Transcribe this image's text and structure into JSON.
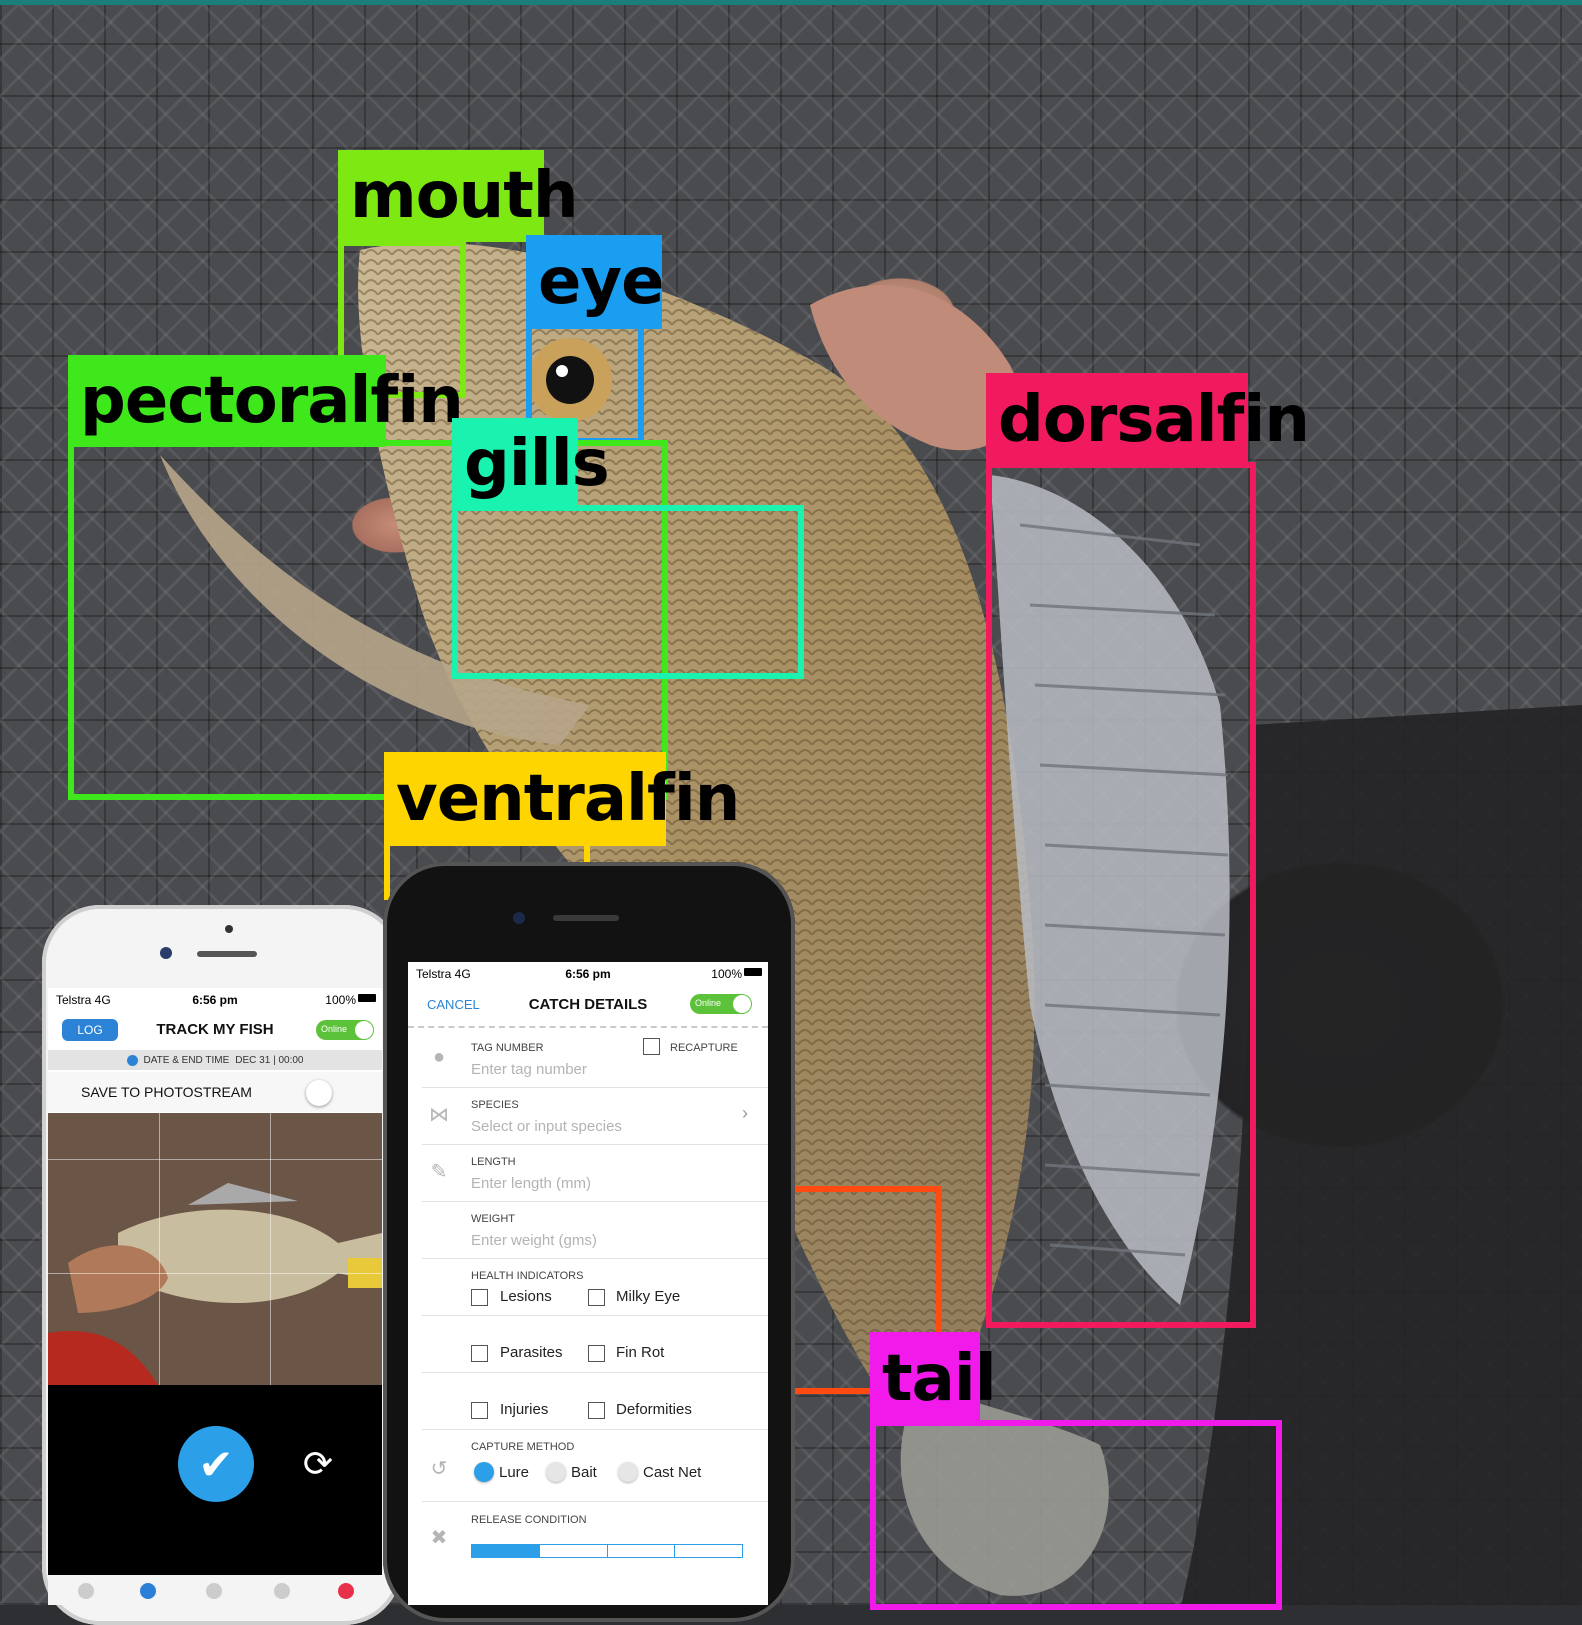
{
  "labels": {
    "mouth": "mouth",
    "eye": "eye",
    "pectoralfin": "pectoralfin",
    "gills": "gills",
    "dorsalfin": "dorsalfin",
    "ventralfin": "ventralfin",
    "tail": "tail"
  },
  "colors": {
    "mouth": "#7de812",
    "eye": "#1a9ef2",
    "pectoralfin": "#3ee81a",
    "gills": "#1af2b0",
    "dorsalfin": "#f21a5e",
    "ventralfin": "#ffd500",
    "tail": "#f21aeb",
    "orange_line": "#ff4a12"
  },
  "phone_left": {
    "status": {
      "carrier": "Telstra  4G",
      "time": "6:56 pm",
      "battery": "100%"
    },
    "log_label": "LOG",
    "title": "TRACK MY FISH",
    "online_label": "Online",
    "date_label": "DATE & END TIME",
    "date_value": "DEC 31 | 00:00",
    "photostream_label": "SAVE TO PHOTOSTREAM",
    "confirm_icon": "checkmark-icon",
    "refresh_icon": "refresh-icon"
  },
  "phone_right": {
    "status": {
      "carrier": "Telstra  4G",
      "time": "6:56 pm",
      "battery": "100%"
    },
    "cancel_label": "CANCEL",
    "title": "CATCH DETAILS",
    "online_label": "Online",
    "tag_label": "TAG NUMBER",
    "tag_placeholder": "Enter tag number",
    "recapture_label": "RECAPTURE",
    "species_label": "SPECIES",
    "species_placeholder": "Select or input species",
    "length_label": "LENGTH",
    "length_placeholder": "Enter length (mm)",
    "weight_label": "WEIGHT",
    "weight_placeholder": "Enter weight (gms)",
    "health_label": "HEALTH INDICATORS",
    "health": [
      "Lesions",
      "Milky Eye",
      "Parasites",
      "Fin Rot",
      "Injuries",
      "Deformities"
    ],
    "capture_label": "CAPTURE METHOD",
    "capture_options": [
      "Lure",
      "Bait",
      "Cast Net"
    ],
    "capture_selected": "Lure",
    "release_label": "RELEASE CONDITION"
  }
}
